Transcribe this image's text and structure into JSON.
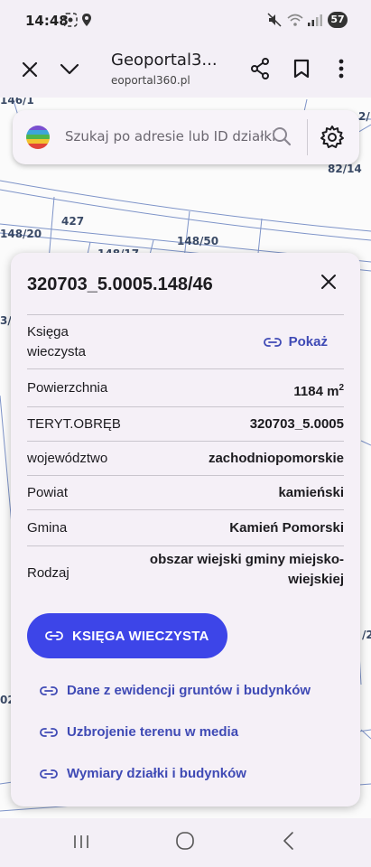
{
  "status_bar": {
    "time": "14:48",
    "battery": "57"
  },
  "browser": {
    "title": "Geoportal3...",
    "url": "eoportal360.pl"
  },
  "map": {
    "labels": [
      "146/1",
      "82/14",
      "148/20",
      "427",
      "148/17",
      "148/50",
      "2/",
      "3/",
      "/2",
      "02"
    ]
  },
  "search": {
    "placeholder": "Szukaj po adresie lub ID działki"
  },
  "parcel": {
    "id": "320703_5.0005.148/46",
    "rows": [
      {
        "key": "Księga wieczysta",
        "value": "Pokaż"
      },
      {
        "key": "Powierzchnia",
        "value": "1184 m",
        "sup": "2"
      },
      {
        "key": "TERYT.OBRĘB",
        "value": "320703_5.0005"
      },
      {
        "key": "województwo",
        "value": "zachodniopomorskie"
      },
      {
        "key": "Powiat",
        "value": "kamieński"
      },
      {
        "key": "Gmina",
        "value": "Kamień Pomorski"
      },
      {
        "key": "Rodzaj",
        "value": "obszar wiejski gminy miejsko-wiejskiej"
      }
    ],
    "primary_button": "KSIĘGA WIECZYSTA",
    "links": [
      "Dane z ewidencji gruntów i budynków",
      "Uzbrojenie terenu w media",
      "Wymiary działki i budynków"
    ]
  },
  "colors": {
    "accent": "#3d45e8",
    "link": "#3f4ab5"
  }
}
